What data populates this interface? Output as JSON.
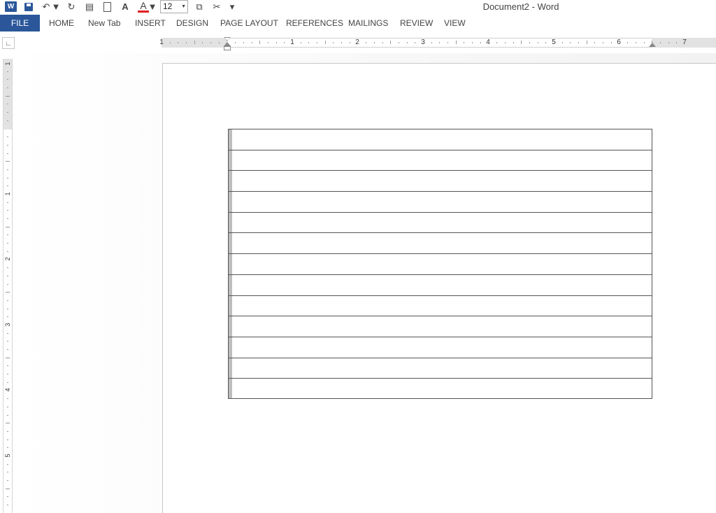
{
  "window": {
    "title": "Document2 - Word"
  },
  "quick_access": {
    "word_logo": "W",
    "font_size": "12",
    "icons": [
      "word-logo-icon",
      "save-icon",
      "undo-icon",
      "redo-icon",
      "paste-icon",
      "new-page-icon",
      "grow-font-icon",
      "font-color-icon",
      "copy-icon",
      "cut-icon",
      "customize-icon"
    ],
    "font_color": "#e01f1f"
  },
  "ribbon": {
    "file": "FILE",
    "tabs": [
      "HOME",
      "New Tab",
      "INSERT",
      "DESIGN",
      "PAGE LAYOUT",
      "REFERENCES",
      "MAILINGS",
      "REVIEW",
      "VIEW"
    ],
    "accent": "#2b579a"
  },
  "ruler": {
    "numbers": [
      "1",
      "1",
      "2",
      "3",
      "4",
      "5",
      "6",
      "7"
    ]
  },
  "vertical_ruler": {
    "numbers": [
      "1",
      "1",
      "2",
      "3",
      "4",
      "5"
    ]
  },
  "document": {
    "table": {
      "rows": 13,
      "columns": 1
    }
  }
}
